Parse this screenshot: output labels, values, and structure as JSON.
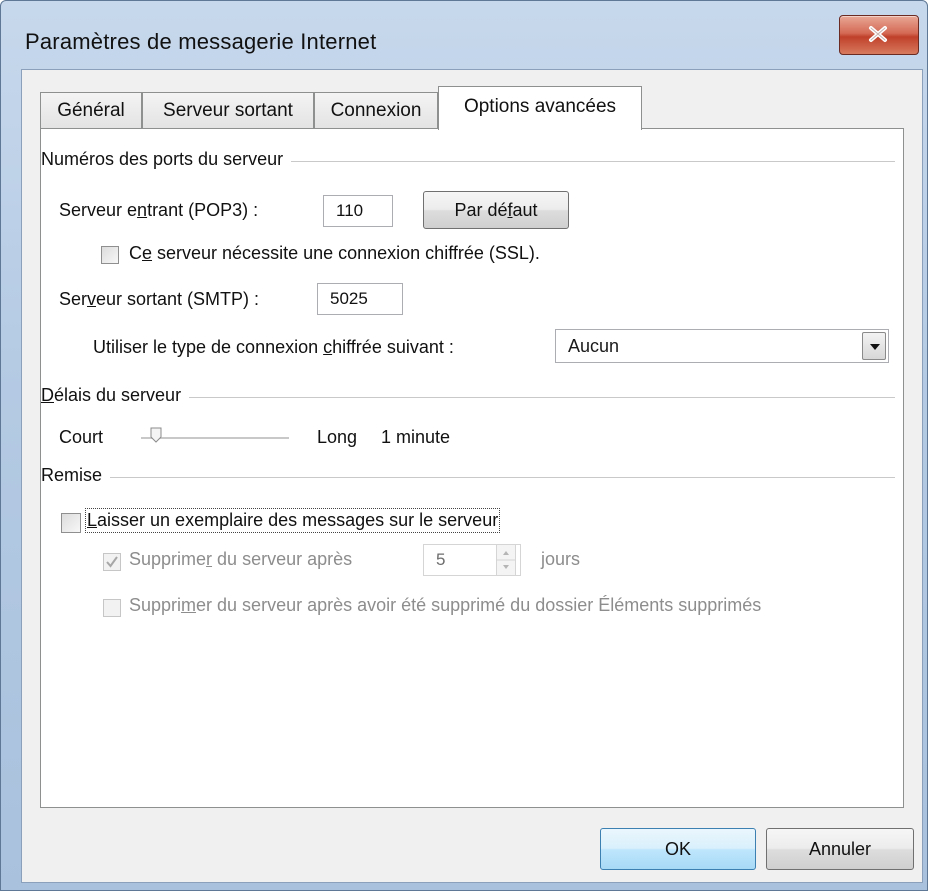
{
  "window": {
    "title": "Paramètres de messagerie Internet"
  },
  "tabs": [
    {
      "label": "Général",
      "active": false
    },
    {
      "label": "Serveur sortant",
      "active": false
    },
    {
      "label": "Connexion",
      "active": false
    },
    {
      "label": "Options avancées",
      "active": true
    }
  ],
  "ports": {
    "group_label": "Numéros des ports du serveur",
    "incoming": {
      "label_pre": "Serveur e",
      "label_u": "n",
      "label_post": "trant (POP3) :",
      "value": "110"
    },
    "default_button": {
      "pre": "Par dé",
      "u": "f",
      "post": "aut"
    },
    "ssl": {
      "pre": "C",
      "u": "e",
      "post": " serveur nécessite une connexion chiffrée (SSL).",
      "checked": false
    },
    "outgoing": {
      "label_pre": "Ser",
      "label_u": "v",
      "label_post": "eur sortant (SMTP) :",
      "value": "5025"
    },
    "encryption": {
      "pre": "Utiliser le type de connexion ",
      "u": "c",
      "post": "hiffrée suivant :",
      "value": "Aucun"
    }
  },
  "timeouts": {
    "group_pre": "",
    "group_u": "D",
    "group_post": "élais du serveur",
    "short_label": "Court",
    "long_label": "Long",
    "value_text": "1 minute",
    "slider_level": 0.1
  },
  "delivery": {
    "group_label": "Remise",
    "leave_copy": {
      "pre": "",
      "u": "L",
      "post": "aisser un exemplaire des messages sur le serveur",
      "checked": false
    },
    "remove_after": {
      "pre": "Supprime",
      "u": "r",
      "post": " du serveur après",
      "checked": true,
      "enabled": false,
      "days": "5",
      "days_label": "jours"
    },
    "remove_deleted": {
      "pre": "Suppri",
      "u": "m",
      "post": "er du serveur après avoir été supprimé du dossier Éléments supprimés",
      "checked": false,
      "enabled": false
    }
  },
  "footer": {
    "ok_label": "OK",
    "cancel_label": "Annuler"
  },
  "colors": {
    "title_bar": "#b5cbe4",
    "close_button": "#c0402a",
    "default_button": "#bee6fd"
  },
  "icons": {
    "close": "close-icon",
    "dropdown": "chevron-down-icon"
  }
}
